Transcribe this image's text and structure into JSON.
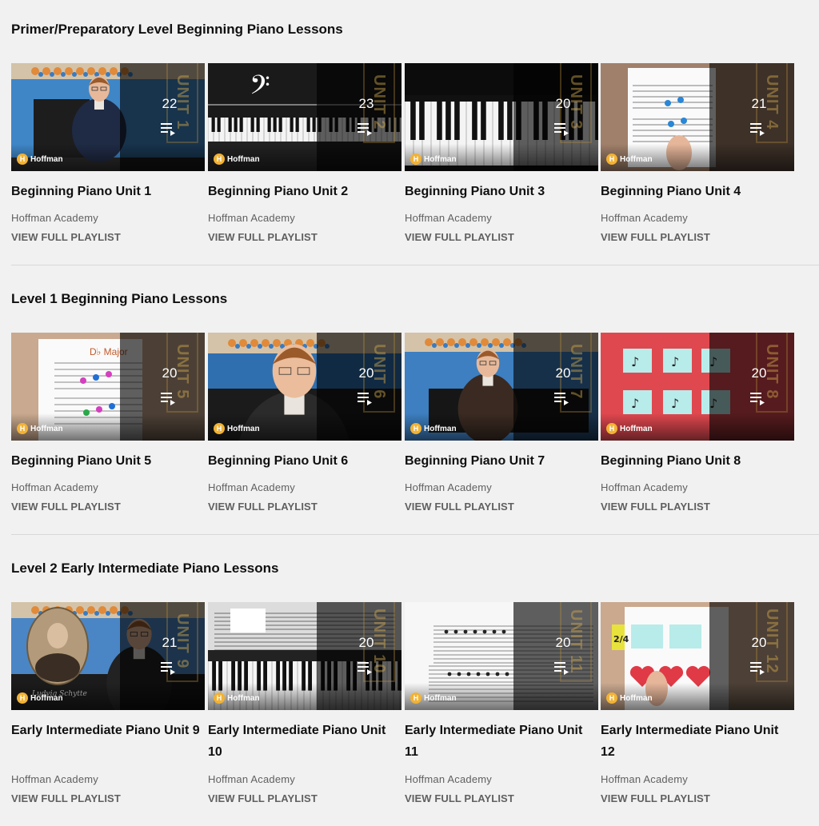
{
  "brand_logo_text": "Hoffman",
  "shelves": [
    {
      "title": "Primer/Preparatory Level Beginning Piano Lessons",
      "cards": [
        {
          "title": "Beginning Piano Unit 1",
          "channel": "Hoffman Academy",
          "link": "VIEW FULL PLAYLIST",
          "count": "22",
          "ribbon": "UNIT 1",
          "art": "teacher-room"
        },
        {
          "title": "Beginning Piano Unit 2",
          "channel": "Hoffman Academy",
          "link": "VIEW FULL PLAYLIST",
          "count": "23",
          "ribbon": "UNIT 2",
          "art": "bass-clef-keys"
        },
        {
          "title": "Beginning Piano Unit 3",
          "channel": "Hoffman Academy",
          "link": "VIEW FULL PLAYLIST",
          "count": "20",
          "ribbon": "UNIT 3",
          "art": "piano-keys"
        },
        {
          "title": "Beginning Piano Unit 4",
          "channel": "Hoffman Academy",
          "link": "VIEW FULL PLAYLIST",
          "count": "21",
          "ribbon": "UNIT 4",
          "art": "staff-board"
        }
      ]
    },
    {
      "title": "Level 1 Beginning Piano Lessons",
      "cards": [
        {
          "title": "Beginning Piano Unit 5",
          "channel": "Hoffman Academy",
          "link": "VIEW FULL PLAYLIST",
          "count": "20",
          "ribbon": "UNIT 5",
          "art": "staff-board-color",
          "art_text": "D♭ Major"
        },
        {
          "title": "Beginning Piano Unit 6",
          "channel": "Hoffman Academy",
          "link": "VIEW FULL PLAYLIST",
          "count": "20",
          "ribbon": "UNIT 6",
          "art": "teacher-close"
        },
        {
          "title": "Beginning Piano Unit 7",
          "channel": "Hoffman Academy",
          "link": "VIEW FULL PLAYLIST",
          "count": "20",
          "ribbon": "UNIT 7",
          "art": "teacher-piano"
        },
        {
          "title": "Beginning Piano Unit 8",
          "channel": "Hoffman Academy",
          "link": "VIEW FULL PLAYLIST",
          "count": "20",
          "ribbon": "UNIT 8",
          "art": "rhythm-cards"
        }
      ]
    },
    {
      "title": "Level 2 Early Intermediate Piano Lessons",
      "cards": [
        {
          "title": "Early Intermediate Piano Unit 9",
          "channel": "Hoffman Academy",
          "link": "VIEW FULL PLAYLIST",
          "count": "21",
          "ribbon": "UNIT 9",
          "art": "portrait",
          "art_text": "Ludvig Schytte"
        },
        {
          "title": "Early Intermediate Piano Unit 10",
          "channel": "Hoffman Academy",
          "link": "VIEW FULL PLAYLIST",
          "count": "20",
          "ribbon": "UNIT 10",
          "art": "sheet-keys"
        },
        {
          "title": "Early Intermediate Piano Unit 11",
          "channel": "Hoffman Academy",
          "link": "VIEW FULL PLAYLIST",
          "count": "20",
          "ribbon": "UNIT 11",
          "art": "sheet-music"
        },
        {
          "title": "Early Intermediate Piano Unit 12",
          "channel": "Hoffman Academy",
          "link": "VIEW FULL PLAYLIST",
          "count": "20",
          "ribbon": "UNIT 12",
          "art": "rhythm-hearts",
          "art_text": "2/4"
        }
      ]
    }
  ]
}
